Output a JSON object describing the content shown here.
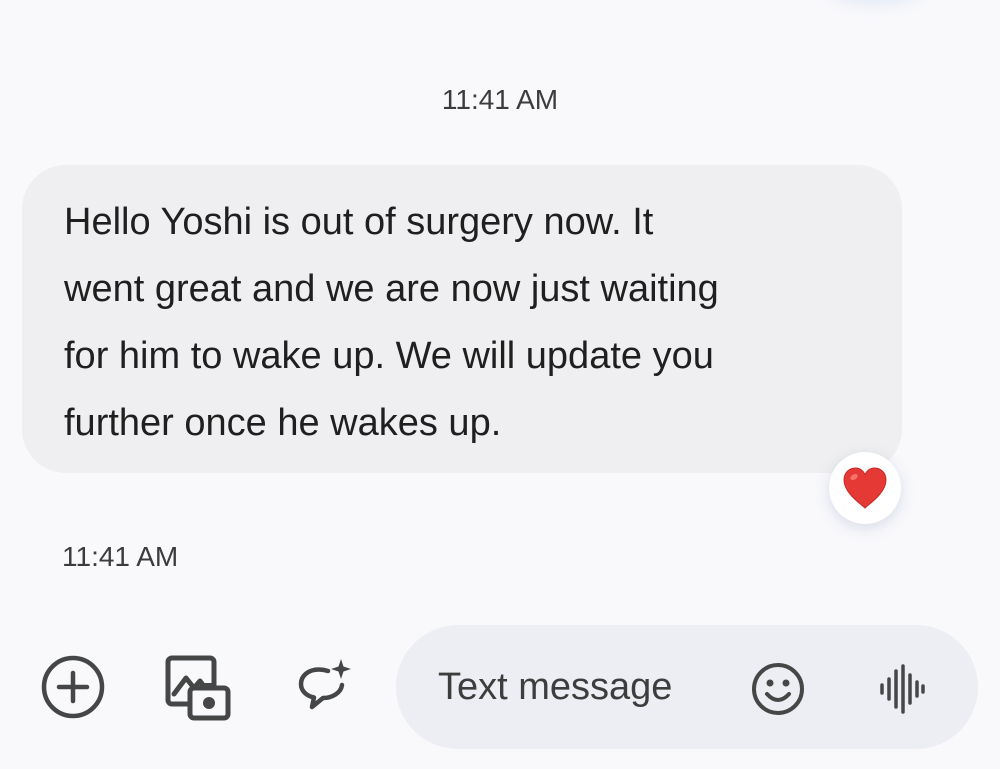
{
  "conversation": {
    "timestamp_top": "11:41 AM",
    "message": {
      "lines": [
        "Hello Yoshi is out of surgery now. It",
        "went great and we are now just waiting",
        "for him to wake up. We will update you",
        "further once he wakes up."
      ],
      "reaction_icon": "red-heart",
      "reaction_color": "#e53935"
    },
    "timestamp_bottom": "11:41 AM"
  },
  "composer": {
    "placeholder": "Text message",
    "icons": {
      "add": "add-circle-icon",
      "gallery": "gallery-camera-icon",
      "magic_compose": "sparkle-chat-icon",
      "emoji": "emoji-icon",
      "voice": "voice-waveform-icon"
    }
  },
  "colors": {
    "background": "#f9f9fc",
    "bubble": "#efeff1",
    "composer": "#eceef3",
    "icon": "#444746"
  }
}
